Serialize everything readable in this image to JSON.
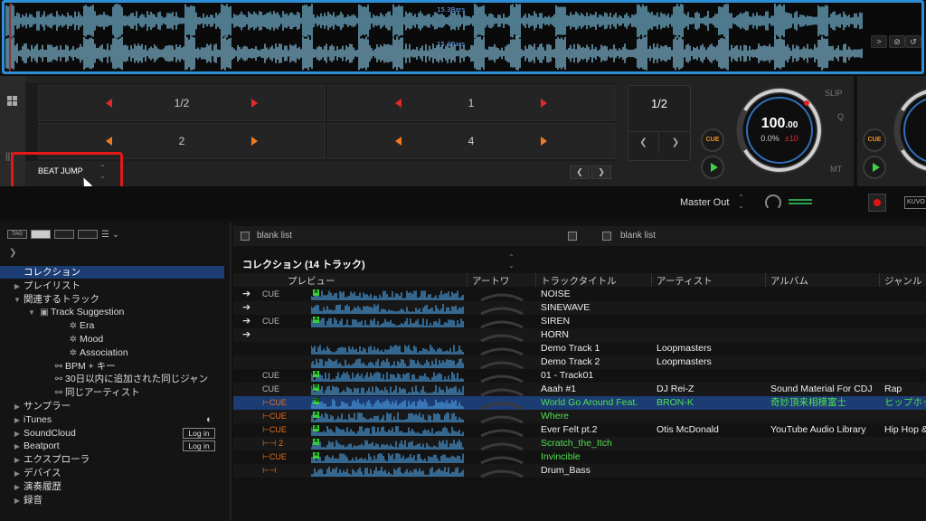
{
  "waveform": {
    "bars_label_1": "15.3Bars",
    "bars_label_2": "15.3Bars",
    "buttons": [
      ">",
      "⊘",
      "↺"
    ]
  },
  "deck": {
    "pads": [
      {
        "label": "1/2",
        "arrow_color": "#e02a2a"
      },
      {
        "label": "1",
        "arrow_color": "#e02a2a"
      },
      {
        "label": "2",
        "arrow_color": "#f07820"
      },
      {
        "label": "4",
        "arrow_color": "#f07820"
      }
    ],
    "mode_label": "BEAT JUMP",
    "loop_value": "1/2",
    "cue_label": "CUE",
    "bpm_int": "100",
    "bpm_dec": ".00",
    "pitch": "0.0%",
    "pitch_range": "±10",
    "slip": "SLIP",
    "q": "Q",
    "mt": "MT"
  },
  "master": {
    "label": "Master Out",
    "brand": "KUVO"
  },
  "tree": {
    "tag_label": "TAG",
    "items": [
      {
        "label": "コレクション",
        "indent": 0,
        "tri": "",
        "icon": "",
        "selected": true
      },
      {
        "label": "プレイリスト",
        "indent": 0,
        "tri": "▶",
        "icon": ""
      },
      {
        "label": "関連するトラック",
        "indent": 0,
        "tri": "▼",
        "icon": ""
      },
      {
        "label": "Track Suggestion",
        "indent": 1,
        "tri": "▼",
        "icon": "▣"
      },
      {
        "label": "Era",
        "indent": 3,
        "tri": "",
        "icon": "✲"
      },
      {
        "label": "Mood",
        "indent": 3,
        "tri": "",
        "icon": "✲"
      },
      {
        "label": "Association",
        "indent": 3,
        "tri": "",
        "icon": "✲"
      },
      {
        "label": "BPM + キー",
        "indent": 2,
        "tri": "",
        "icon": "⚯"
      },
      {
        "label": "30日以内に追加された同じジャン",
        "indent": 2,
        "tri": "",
        "icon": "⚯"
      },
      {
        "label": "同じアーティスト",
        "indent": 2,
        "tri": "",
        "icon": "⚯"
      },
      {
        "label": "サンプラー",
        "indent": 0,
        "tri": "▶",
        "icon": ""
      },
      {
        "label": "iTunes",
        "indent": 0,
        "tri": "▶",
        "icon": "",
        "badge": "◐"
      },
      {
        "label": "SoundCloud",
        "indent": 0,
        "tri": "▶",
        "icon": "",
        "login": "Log in"
      },
      {
        "label": "Beatport",
        "indent": 0,
        "tri": "▶",
        "icon": "",
        "login": "Log in"
      },
      {
        "label": "エクスプローラ",
        "indent": 0,
        "tri": "▶",
        "icon": ""
      },
      {
        "label": "デバイス",
        "indent": 0,
        "tri": "▶",
        "icon": ""
      },
      {
        "label": "演奏履歴",
        "indent": 0,
        "tri": "▶",
        "icon": ""
      },
      {
        "label": "録音",
        "indent": 0,
        "tri": "▶",
        "icon": ""
      }
    ]
  },
  "list": {
    "header_left": "blank list",
    "header_right": "blank list",
    "title": "コレクション (14 トラック)",
    "columns": [
      "プレビュー",
      "アートワ",
      "トラックタイトル",
      "アーティスト",
      "アルバム",
      "ジャンル"
    ],
    "rows": [
      {
        "arrow": "➔",
        "cue": "CUE",
        "hc": "A",
        "title": "NOISE",
        "artist": "",
        "album": "",
        "genre": ""
      },
      {
        "arrow": "➔",
        "cue": "",
        "hc": "",
        "title": "SINEWAVE",
        "artist": "",
        "album": "",
        "genre": ""
      },
      {
        "arrow": "➔",
        "cue": "CUE",
        "hc": "A",
        "title": "SIREN",
        "artist": "",
        "album": "",
        "genre": ""
      },
      {
        "arrow": "➔",
        "cue": "",
        "hc": "",
        "title": "HORN",
        "artist": "",
        "album": "",
        "genre": ""
      },
      {
        "arrow": "",
        "cue": "",
        "hc": "",
        "title": "Demo Track 1",
        "artist": "Loopmasters",
        "album": "",
        "genre": ""
      },
      {
        "arrow": "",
        "cue": "",
        "hc": "",
        "title": "Demo Track 2",
        "artist": "Loopmasters",
        "album": "",
        "genre": ""
      },
      {
        "arrow": "",
        "cue": "CUE",
        "hc": "A",
        "title": "01 - Track01",
        "artist": "",
        "album": "",
        "genre": ""
      },
      {
        "arrow": "",
        "cue": "CUE",
        "hc": "H",
        "title": "Aaah #1",
        "artist": "DJ Rei-Z",
        "album": "Sound Material For CDJ",
        "genre": "Rap"
      },
      {
        "arrow": "",
        "cue": "⊢CUE",
        "hc": "HE",
        "title": "World Go Around Feat.",
        "artist": "BRON-K",
        "album": "奇妙頂来相模富士",
        "genre": "ヒップホッ",
        "selected": true,
        "green": true
      },
      {
        "arrow": "",
        "cue": "⊢CUE",
        "hc": "A",
        "title": "Where",
        "artist": "",
        "album": "",
        "genre": "",
        "green": true
      },
      {
        "arrow": "",
        "cue": "⊢CUE",
        "hc": "B",
        "title": "Ever Felt pt.2",
        "artist": "Otis McDonald",
        "album": "YouTube Audio Library",
        "genre": "Hip Hop &"
      },
      {
        "arrow": "",
        "cue": "⊢⊣ 2",
        "hc": "A",
        "title": "Scratch_the_Itch",
        "artist": "",
        "album": "",
        "genre": "",
        "green": true
      },
      {
        "arrow": "",
        "cue": "⊢CUE",
        "hc": "A",
        "title": "Invincible",
        "artist": "",
        "album": "",
        "genre": "",
        "green": true
      },
      {
        "arrow": "",
        "cue": "⊢⊣",
        "hc": "",
        "title": "Drum_Bass",
        "artist": "",
        "album": "",
        "genre": ""
      }
    ]
  }
}
